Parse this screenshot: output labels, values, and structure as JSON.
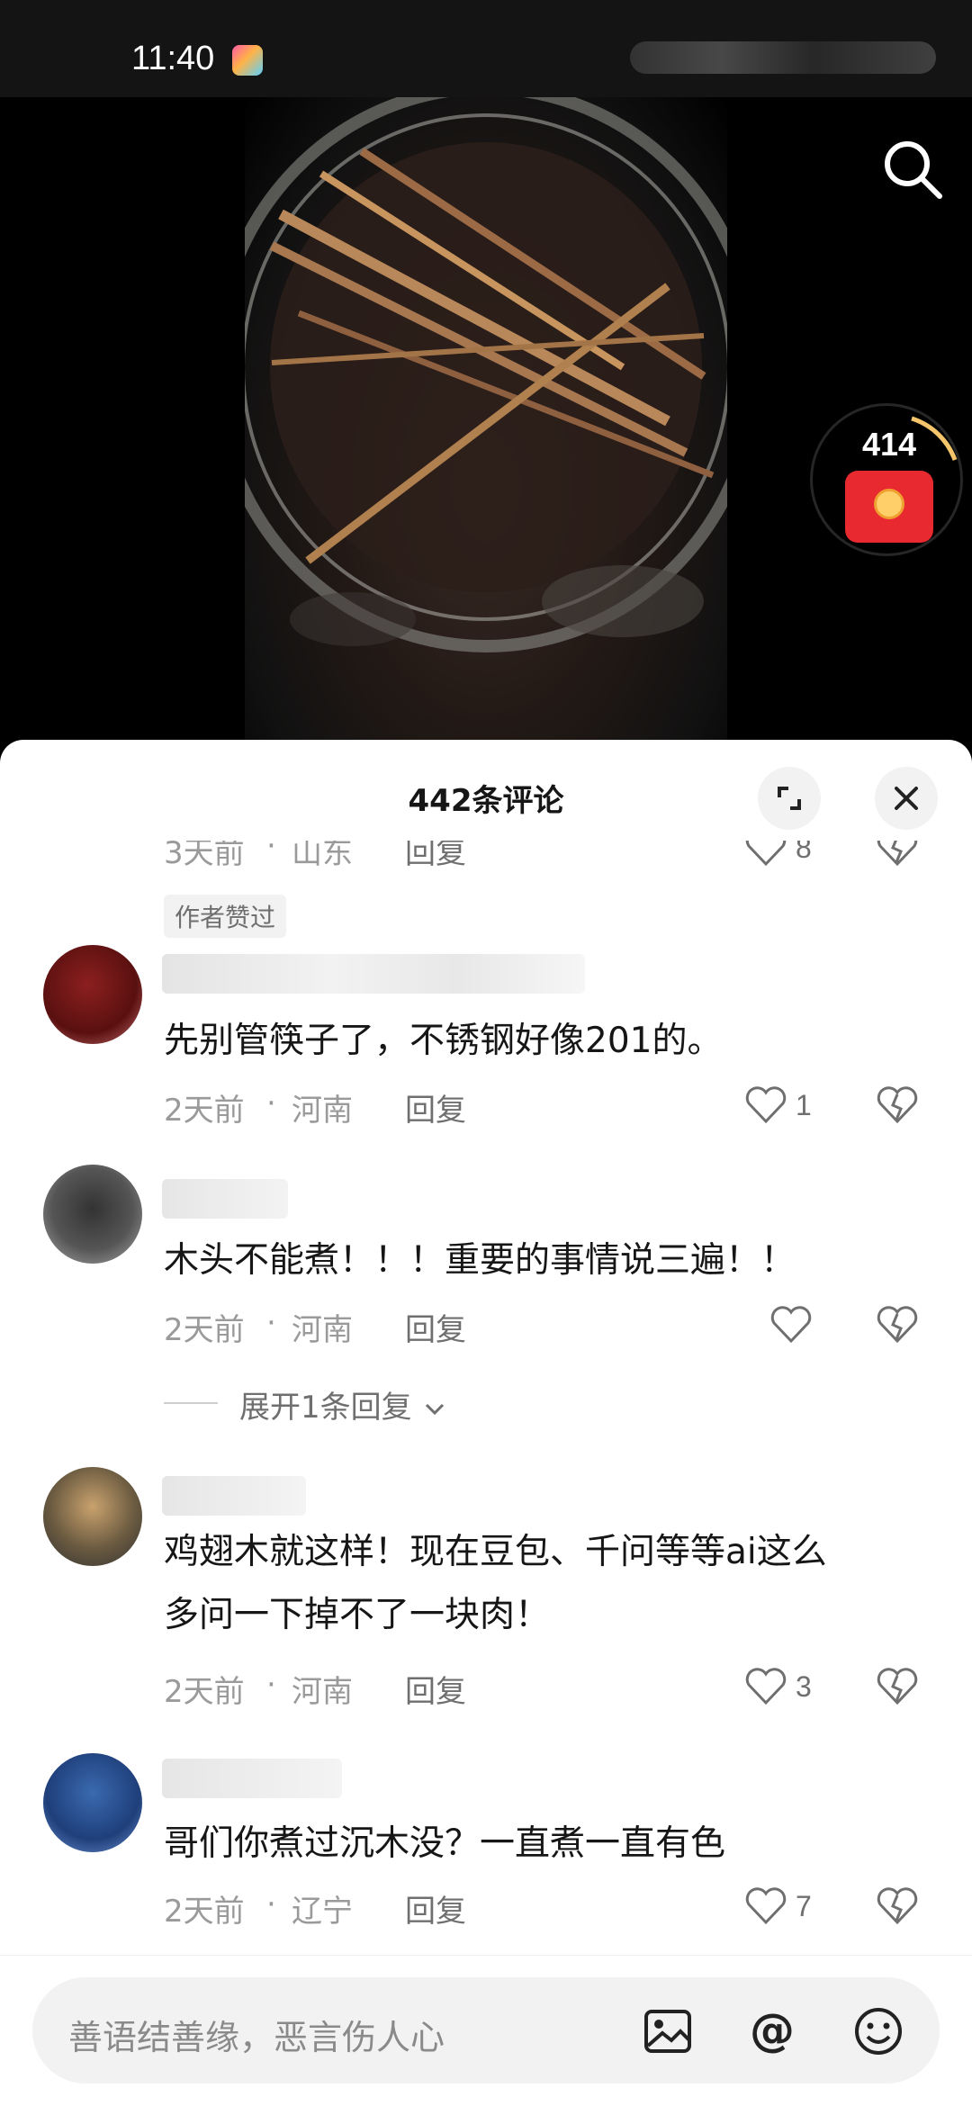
{
  "status_bar": {
    "time": "11:40"
  },
  "video": {
    "redpacket_count": "414"
  },
  "comments_panel": {
    "title": "442条评论",
    "top_partial": {
      "time": "3天前",
      "location": "山东",
      "reply": "回复",
      "likes": "8"
    },
    "author_badge": "作者赞过",
    "comments": [
      {
        "text": "先别管筷子了，不锈钢好像201的。",
        "time": "2天前",
        "location": "河南",
        "reply": "回复",
        "likes": "1"
      },
      {
        "text": "木头不能煮！！！重要的事情说三遍！！",
        "time": "2天前",
        "location": "河南",
        "reply": "回复",
        "likes": ""
      },
      {
        "text_line1": "鸡翅木就这样！现在豆包、千问等等ai这么",
        "text_line2": "多问一下掉不了一块肉！",
        "time": "2天前",
        "location": "河南",
        "reply": "回复",
        "likes": "3"
      },
      {
        "text": "哥们你煮过沉木没？一直煮一直有色",
        "time": "2天前",
        "location": "辽宁",
        "reply": "回复",
        "likes": "7"
      }
    ],
    "expand_replies": "展开1条回复",
    "separator": "·"
  },
  "input": {
    "placeholder": "善语结善缘，恶言伤人心"
  },
  "icons": [
    "search-icon",
    "expand-icon",
    "close-icon",
    "heart-icon",
    "dislike-icon",
    "chevron-down-icon",
    "image-icon",
    "at-icon",
    "emoji-icon",
    "red-packet-icon"
  ],
  "colors": {
    "accent_red": "#e8292f",
    "panel_bg": "#ffffff",
    "muted_text": "#9a9a9a"
  }
}
